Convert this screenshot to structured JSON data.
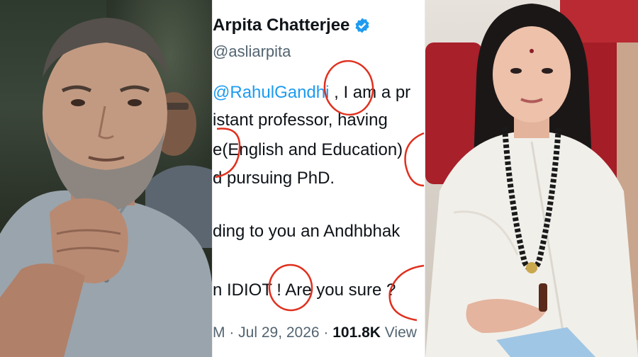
{
  "tweet": {
    "name": "Arpita Chatterjee",
    "handle": "@asliarpita",
    "mention": "@RahulGandhi",
    "line1_rest": " , I am a pr",
    "line2": "istant professor, having",
    "line3": "e(English and Education)",
    "line4": "d pursuing PhD.",
    "line5": "ding to you an Andhbhak",
    "line6": "n IDIOT ! Are you sure ?",
    "meta_date": "M · Jul 29, 2026 · ",
    "meta_views": "101.8K",
    "meta_views_label": " View"
  },
  "colors": {
    "verified_badge": "#1d9bf0",
    "mention_blue": "#1d9bf0",
    "annotation_red": "#e0301e"
  },
  "icons": {
    "verified": "verified-badge-icon"
  }
}
